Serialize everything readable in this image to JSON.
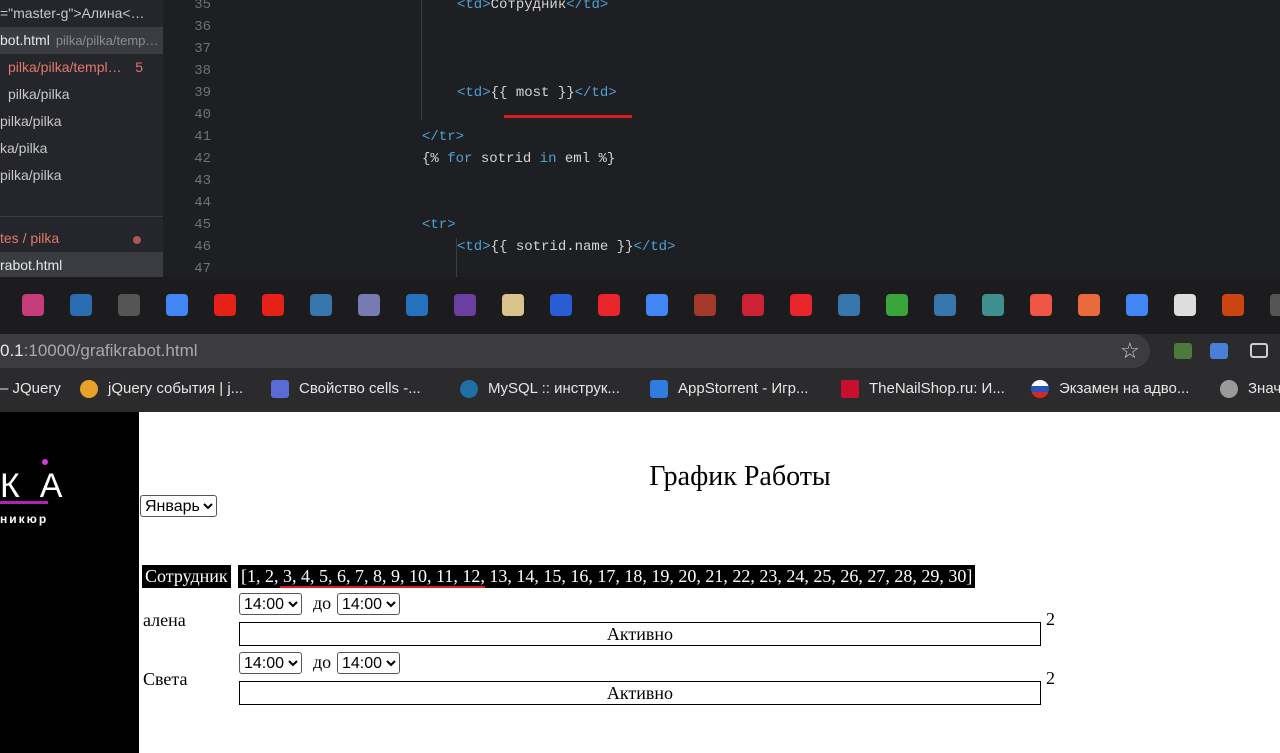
{
  "editor": {
    "explorer": [
      {
        "name": "=\"master-g\">Алина<…",
        "path": ""
      },
      {
        "name": "bot.html",
        "path": "pilka/pilka/temp…"
      },
      {
        "name": "pilka/pilka/templ…",
        "path": "",
        "badge": "5"
      },
      {
        "name": "pilka/pilka",
        "path": ""
      },
      {
        "name": "pilka/pilka",
        "path": ""
      },
      {
        "name": "ka/pilka",
        "path": ""
      },
      {
        "name": "pilka/pilka",
        "path": ""
      },
      {
        "name": "tes / pilka",
        "path": ""
      },
      {
        "name": "rabot.html",
        "path": ""
      }
    ],
    "line_numbers": [
      "35",
      "36",
      "37",
      "38",
      "39",
      "40",
      "41",
      "42",
      "43",
      "44",
      "45",
      "46",
      "47"
    ],
    "code": {
      "l35_open": "<td>",
      "l35_text": "Сотрудник",
      "l35_close": "</td>",
      "l39_open": "<td>",
      "l39_text": "{{ most }}",
      "l39_close": "</td>",
      "l41": "</tr>",
      "l42_a": "{%",
      "l42_for": "for",
      "l42_var": "sotrid",
      "l42_in": "in",
      "l42_list": "eml",
      "l42_b": "%}",
      "l45": "<tr>",
      "l46_open": "<td>",
      "l46_text": "{{ sotrid.name }}",
      "l46_close": "</td>"
    }
  },
  "browser": {
    "url_prefix": "0.1",
    "url_rest": ":10000/grafikrabot.html",
    "bookmarks": [
      {
        "label": "– JQuery",
        "color": "#2b2b2e"
      },
      {
        "label": "jQuery события | j...",
        "color": "#e8a12a"
      },
      {
        "label": "Свойство cells -...",
        "color": "#5b6bd6"
      },
      {
        "label": "MySQL :: инструк...",
        "color": "#1d6fa5"
      },
      {
        "label": "AppStorrent - Игр...",
        "color": "#2f7de1"
      },
      {
        "label": "TheNailShop.ru: И...",
        "color": "#c8102e"
      },
      {
        "label": "Экзамен на адво...",
        "color": "#d52b1e"
      },
      {
        "label": "Знач",
        "color": "#9a9a9a"
      }
    ],
    "icons": [
      "instagram-icon",
      "stackoverflow-icon",
      "globe-icon",
      "google-icon",
      "youtube-icon",
      "youtube-icon",
      "python-icon",
      "php-icon",
      "powershell-icon",
      "wolf-icon",
      "bars-icon",
      "vk-icon",
      "yandex-icon",
      "google-icon",
      "grid-icon",
      "tower-icon",
      "yandex-icon",
      "python-icon",
      "code-icon",
      "python-icon",
      "hub-icon",
      "pinwheel-icon",
      "b-icon",
      "google-icon",
      "w3-icon",
      "pd-icon",
      "globe-icon"
    ]
  },
  "page": {
    "logo_text": "КА",
    "logo_sub": "никюр",
    "title": "График Работы",
    "month_selected": "Январь",
    "header_employee": "Сотрудник",
    "header_days": "[1, 2, 3, 4, 5, 6, 7, 8, 9, 10, 11, 12, 13, 14, 15, 16, 17, 18, 19, 20, 21, 22, 23, 24, 25, 26, 27, 28, 29, 30]",
    "rows": [
      {
        "name": "алена",
        "from": "14:00",
        "sep": "до",
        "to": "14:00",
        "status": "Активно",
        "count": "2"
      },
      {
        "name": "Света",
        "from": "14:00",
        "sep": "до",
        "to": "14:00",
        "status": "Активно",
        "count": "2"
      }
    ]
  }
}
